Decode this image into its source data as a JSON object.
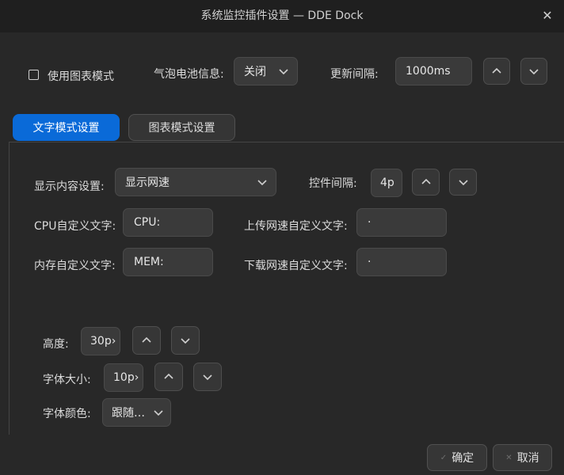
{
  "window": {
    "title": "系统监控插件设置 — DDE Dock"
  },
  "top": {
    "chart_mode_label": "使用图表模式",
    "battery_label": "气泡电池信息:",
    "battery_value": "关闭",
    "interval_label": "更新间隔:",
    "interval_value": "1000ms"
  },
  "tabs": [
    {
      "label": "文字模式设置",
      "active": true
    },
    {
      "label": "图表模式设置",
      "active": false
    }
  ],
  "text_mode": {
    "display_label": "显示内容设置:",
    "display_value": "显示网速",
    "spacing_label": "控件间隔:",
    "spacing_value": "4p",
    "cpu_label": "CPU自定义文字:",
    "cpu_value": "CPU:",
    "upload_label": "上传网速自定义文字:",
    "upload_value": "·",
    "mem_label": "内存自定义文字:",
    "mem_value": "MEM:",
    "download_label": "下载网速自定义文字:",
    "download_value": "·",
    "height_label": "高度:",
    "height_value": "30p›",
    "font_size_label": "字体大小:",
    "font_size_value": "10p›",
    "font_color_label": "字体颜色:",
    "font_color_value": "跟随…"
  },
  "footer": {
    "ok_label": "确定",
    "cancel_label": "取消"
  },
  "colors": {
    "accent": "#0a6ad8",
    "background": "#282828",
    "titlebar": "#1f1f1f"
  }
}
